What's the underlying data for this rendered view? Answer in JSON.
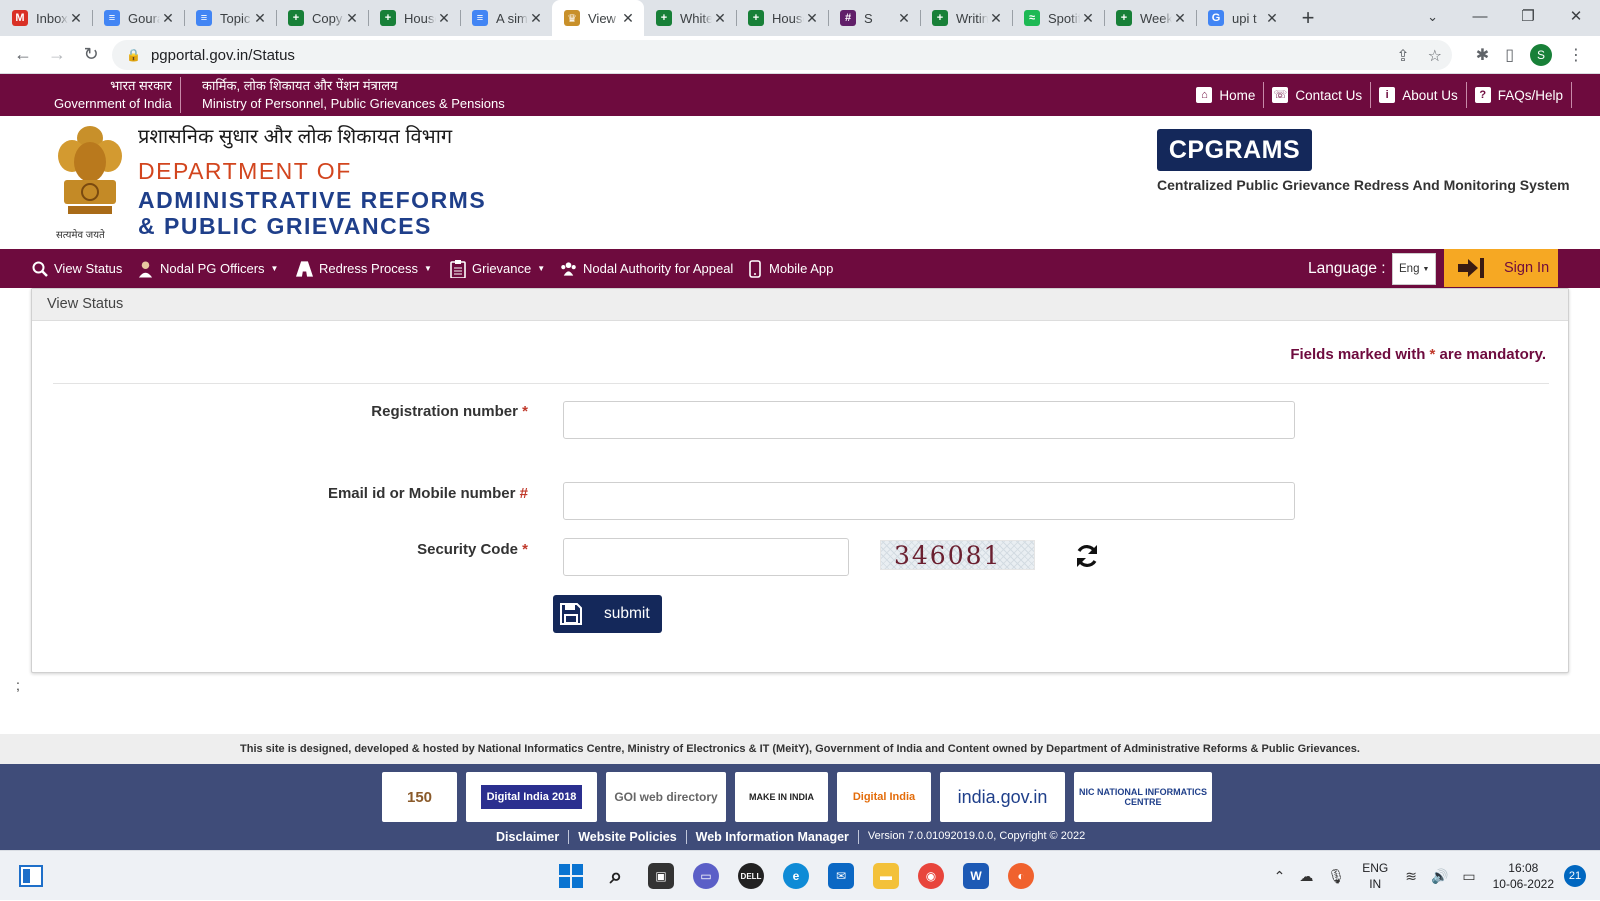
{
  "browser": {
    "tabs": [
      {
        "title": "Inbox",
        "icon": "gmail-icon",
        "color": "#d93025",
        "glyph": "M"
      },
      {
        "title": "Gourav",
        "icon": "docs-icon",
        "color": "#4285f4",
        "glyph": "≡"
      },
      {
        "title": "Topic",
        "icon": "docs-icon",
        "color": "#4285f4",
        "glyph": "≡"
      },
      {
        "title": "Copy",
        "icon": "sheets-icon",
        "color": "#188038",
        "glyph": "+"
      },
      {
        "title": "House",
        "icon": "sheets-icon",
        "color": "#188038",
        "glyph": "+"
      },
      {
        "title": "A simple",
        "icon": "docs-icon",
        "color": "#4285f4",
        "glyph": "≡"
      },
      {
        "title": "View",
        "icon": "emblem-icon",
        "color": "#c8902a",
        "glyph": "♛"
      },
      {
        "title": "White",
        "icon": "sheets-icon",
        "color": "#188038",
        "glyph": "+"
      },
      {
        "title": "House",
        "icon": "sheets-icon",
        "color": "#188038",
        "glyph": "+"
      },
      {
        "title": "S",
        "icon": "slack-icon",
        "color": "#611f69",
        "glyph": "#"
      },
      {
        "title": "Writing",
        "icon": "sheets-icon",
        "color": "#188038",
        "glyph": "+"
      },
      {
        "title": "Spotify",
        "icon": "spotify-icon",
        "color": "#1db954",
        "glyph": "≈"
      },
      {
        "title": "Week",
        "icon": "sheets-icon",
        "color": "#188038",
        "glyph": "+"
      },
      {
        "title": "upi t",
        "icon": "google-icon",
        "color": "#4285f4",
        "glyph": "G"
      }
    ],
    "active_tab_index": 6,
    "url": "pgportal.gov.in/Status",
    "profile_initial": "S"
  },
  "gov_strip": {
    "hindi_left": "भारत सरकार",
    "english_left": "Government of India",
    "hindi_mid": "कार्मिक, लोक शिकायत और पेंशन मंत्रालय",
    "english_mid": "Ministry of Personnel, Public Grievances & Pensions",
    "links": [
      {
        "label": "Home",
        "icon": "home-icon"
      },
      {
        "label": "Contact Us",
        "icon": "phone-icon"
      },
      {
        "label": "About Us",
        "icon": "info-icon"
      },
      {
        "label": "FAQs/Help",
        "icon": "question-icon"
      }
    ]
  },
  "branding": {
    "hindi_title": "प्रशासनिक सुधार और लोक शिकायत विभाग",
    "line1": "DEPARTMENT OF",
    "line2": "ADMINISTRATIVE REFORMS",
    "line3": "& PUBLIC GRIEVANCES",
    "emblem_caption": "सत्यमेव जयते",
    "cpgrams_logo": "CPGRAMS",
    "cpgrams_tagline": "Centralized Public Grievance Redress And Monitoring System"
  },
  "nav": {
    "items": [
      {
        "label": "View Status",
        "icon": "search-icon",
        "dropdown": false
      },
      {
        "label": "Nodal PG Officers",
        "icon": "officer-icon",
        "dropdown": true
      },
      {
        "label": "Redress Process",
        "icon": "road-icon",
        "dropdown": true
      },
      {
        "label": "Grievance",
        "icon": "clipboard-icon",
        "dropdown": true
      },
      {
        "label": "Nodal Authority for Appeal",
        "icon": "users-icon",
        "dropdown": false
      },
      {
        "label": "Mobile App",
        "icon": "mobile-icon",
        "dropdown": false
      }
    ],
    "language_label": "Language :",
    "language_value": "Eng",
    "signin_label": "Sign In"
  },
  "form": {
    "panel_title": "View Status",
    "mandatory_note_pre": "Fields marked with ",
    "mandatory_note_star": "*",
    "mandatory_note_post": " are mandatory.",
    "fields": [
      {
        "label": "Registration number",
        "marker": "*",
        "value": ""
      },
      {
        "label": "Email id or Mobile number",
        "marker": "#",
        "value": ""
      },
      {
        "label": "Security Code",
        "marker": "*",
        "value": ""
      }
    ],
    "captcha_text": "346081",
    "submit_label": "submit"
  },
  "stray_text": ";",
  "footer": {
    "credit": "This site is designed, developed & hosted by National Informatics Centre, Ministry of Electronics & IT (MeitY), Government of India and Content owned by Department of Administrative Reforms & Public Grievances.",
    "logos": [
      {
        "name": "150-years-logo",
        "text": "150"
      },
      {
        "name": "digital-india-2018-logo",
        "text": "Digital India 2018"
      },
      {
        "name": "goi-web-directory-logo",
        "text": "GOI web directory"
      },
      {
        "name": "make-in-india-logo",
        "text": "MAKE IN INDIA"
      },
      {
        "name": "digital-india-logo",
        "text": "Digital India"
      },
      {
        "name": "india-gov-logo",
        "text": "india.gov.in"
      },
      {
        "name": "nic-logo",
        "text": "NIC NATIONAL INFORMATICS CENTRE"
      }
    ],
    "links": [
      "Disclaimer",
      "Website Policies",
      "Web Information Manager",
      "Version 7.0.01092019.0.0, Copyright © 2022"
    ]
  },
  "taskbar": {
    "lang_top": "ENG",
    "lang_bottom": "IN",
    "time": "16:08",
    "date": "10-06-2022",
    "notification_count": "21"
  },
  "colors": {
    "maroon": "#6e0b3e",
    "navy": "#14285a",
    "orange": "#f6a823",
    "footer_blue": "#3f4c79",
    "required_red": "#c0392b"
  }
}
